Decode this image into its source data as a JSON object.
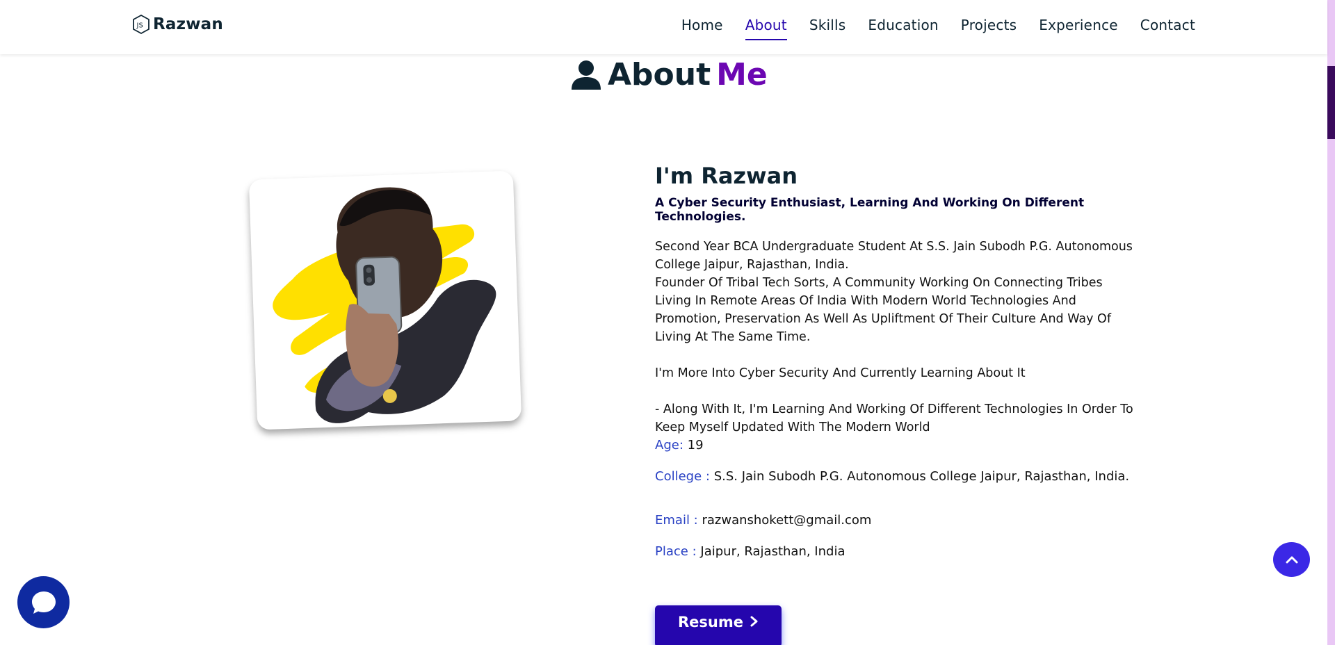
{
  "brand": {
    "name": "Razwan",
    "icon": "js-hexagon-icon"
  },
  "nav": {
    "items": [
      {
        "label": "Home",
        "active": false
      },
      {
        "label": "About",
        "active": true
      },
      {
        "label": "Skills",
        "active": false
      },
      {
        "label": "Education",
        "active": false
      },
      {
        "label": "Projects",
        "active": false
      },
      {
        "label": "Experience",
        "active": false
      },
      {
        "label": "Contact",
        "active": false
      }
    ]
  },
  "section": {
    "title_main": "About",
    "title_accent": "Me",
    "icon": "user-icon"
  },
  "about": {
    "name": "I'm Razwan",
    "tagline": "A Cyber Security Enthusiast, Learning And Working On Different Technologies.",
    "bio_1": "Second Year BCA Undergraduate Student At S.S. Jain Subodh P.G. Autonomous College Jaipur, Rajasthan, India.",
    "bio_2": "Founder Of Tribal Tech Sorts, A Community Working On Connecting Tribes Living In Remote Areas Of India With Modern World Technologies And Promotion, Preservation As Well As Upliftment Of Their Culture And Way Of Living At The Same Time.",
    "bio_3": "I'm More Into Cyber Security And Currently Learning About It",
    "bio_4": "- Along With It, I'm Learning And Working Of Different Technologies In Order To Keep Myself Updated With The Modern World",
    "age_label": "Age:",
    "age_value": "19",
    "college_label": "College :",
    "college_value": "S.S. Jain Subodh P.G. Autonomous College Jaipur, Rajasthan, India.",
    "email_label": "Email :",
    "email_value": "razwanshokett@gmail.com",
    "place_label": "Place :",
    "place_value": "Jaipur, Rajasthan, India",
    "resume_label": "Resume"
  },
  "colors": {
    "primary": "#2506ad",
    "accent": "#6c07b2",
    "label": "#2941c4"
  },
  "floating": {
    "chat_icon": "chat-bubble-icon",
    "top_icon": "chevron-up-icon"
  }
}
